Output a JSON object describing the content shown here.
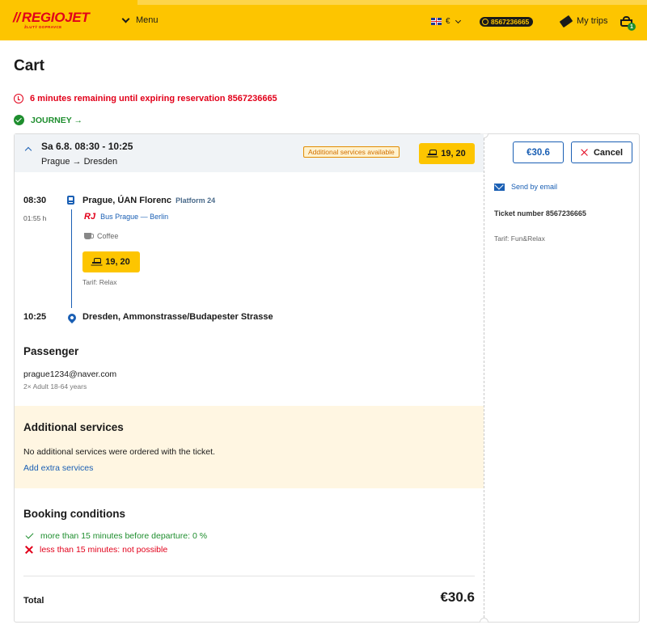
{
  "header": {
    "logo_text": "REGIOJET",
    "logo_slashes": "//",
    "logo_sub": "ŽLUTÝ DOPRAVCE",
    "menu_label": "Menu",
    "currency": "€",
    "account_number": "8567236665",
    "my_trips": "My trips",
    "cart_count": "1"
  },
  "page": {
    "title": "Cart",
    "expiry_message": "6 minutes remaining until expiring reservation 8567236665",
    "journey_step": "JOURNEY →"
  },
  "journey": {
    "date_time": "Sa 6.8. 08:30 - 10:25",
    "cities": "Prague → Dresden",
    "additional_services_badge": "Additional services available",
    "seats": "19, 20",
    "departure": {
      "time": "08:30",
      "duration": "01:55 h",
      "station": "Prague, ÚAN Florenc",
      "platform": "Platform 24"
    },
    "carrier_logo": "RJ",
    "carrier_line": "Bus Prague — Berlin",
    "amenity": "Coffee",
    "segment_seats": "19, 20",
    "segment_tarif": "Tarif: Relax",
    "arrival": {
      "time": "10:25",
      "station": "Dresden, Ammonstrasse/Budapester Strasse"
    }
  },
  "passenger": {
    "title": "Passenger",
    "email": "prague1234@naver.com",
    "type": "2× Adult 18-64 years"
  },
  "additional_services": {
    "title": "Additional services",
    "text": "No additional services were ordered with the ticket.",
    "link": "Add extra services"
  },
  "booking_conditions": {
    "title": "Booking conditions",
    "allowed": "more than 15 minutes before departure: 0 %",
    "denied": "less than 15 minutes: not possible"
  },
  "total": {
    "label": "Total",
    "value": "€30.6"
  },
  "side_panel": {
    "price": "€30.6",
    "cancel": "Cancel",
    "send_email": "Send by email",
    "ticket_number": "Ticket number 8567236665",
    "tarif": "Tarif: Fun&Relax"
  },
  "colors": {
    "brand_yellow": "#fdc500",
    "brand_red": "#e2001a",
    "link_blue": "#1a5fb4",
    "success_green": "#1e8e2e"
  }
}
